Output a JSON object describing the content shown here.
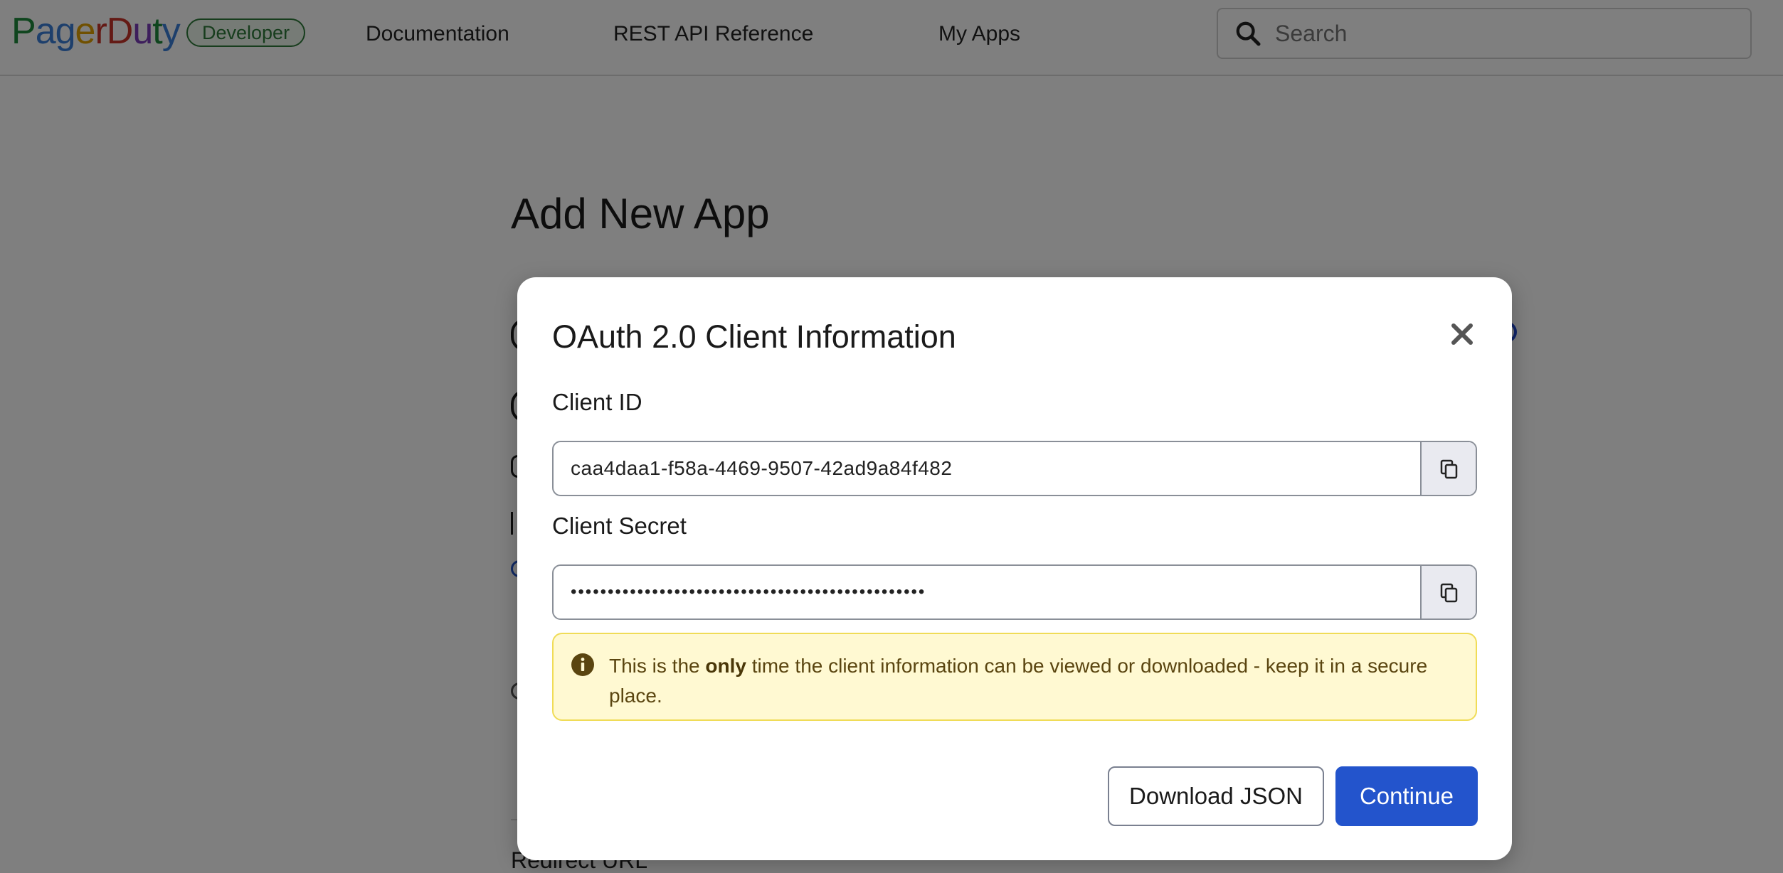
{
  "brand": {
    "logo_text": "PagerDuty",
    "badge": "Developer",
    "logo_colors": [
      "#1f8a3c",
      "#3a7fd8",
      "#e0a100",
      "#c8342a",
      "#7a3cb8"
    ]
  },
  "nav": {
    "links": [
      "Documentation",
      "REST API Reference",
      "My Apps"
    ]
  },
  "search": {
    "placeholder": "Search"
  },
  "page": {
    "title": "Add New App",
    "redirect_label": "Redirect URL"
  },
  "modal": {
    "title": "OAuth 2.0 Client Information",
    "client_id_label": "Client ID",
    "client_id_value": "caa4daa1-f58a-4469-9507-42ad9a84f482",
    "client_secret_label": "Client Secret",
    "client_secret_value": "••••••••••••••••••••••••••••••••••••••••••••••••",
    "alert": {
      "prefix": "This is the ",
      "emphasis": "only",
      "suffix": " time the client information can be viewed or downloaded - keep it in a secure place."
    },
    "download_label": "Download JSON",
    "continue_label": "Continue"
  },
  "colors": {
    "primary": "#2354cc",
    "alert_bg": "#fff9d2",
    "alert_border": "#f0dc57",
    "badge_green": "#2f7a3a"
  },
  "icons": {
    "search": "search-icon",
    "close": "close-icon",
    "copy": "copy-icon",
    "info": "info-icon"
  }
}
